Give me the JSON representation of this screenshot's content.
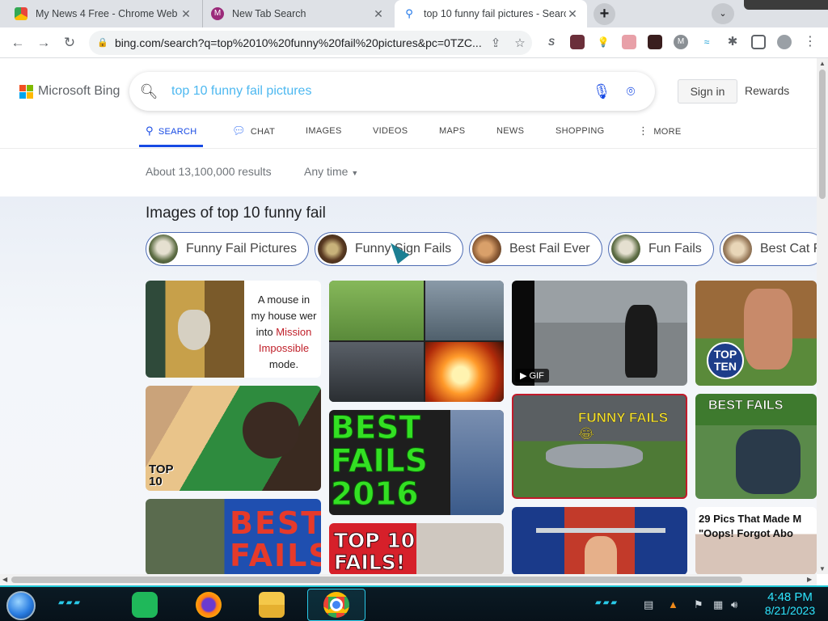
{
  "tabs": [
    {
      "title": "My News 4 Free - Chrome Web S",
      "close": "✕",
      "favicon_color": "#e8453c"
    },
    {
      "title": "New Tab Search",
      "close": "✕",
      "favicon_color": "#9b2a7a"
    },
    {
      "title": "top 10 funny fail pictures - Search",
      "close": "✕",
      "favicon_color": "#1a73e8"
    }
  ],
  "browser": {
    "new_tab": "+",
    "url": "bing.com/search?q=top%2010%20funny%20fail%20pictures&pc=0TZC...",
    "back": "←",
    "forward": "→",
    "reload": "↻"
  },
  "bing": {
    "brand": "Microsoft Bing",
    "query": "top 10 funny fail pictures",
    "sign_in": "Sign in",
    "rewards": "Rewards",
    "scopes": [
      {
        "label": "SEARCH",
        "active": true
      },
      {
        "label": "CHAT",
        "active": false
      },
      {
        "label": "IMAGES",
        "active": false
      },
      {
        "label": "VIDEOS",
        "active": false
      },
      {
        "label": "MAPS",
        "active": false
      },
      {
        "label": "NEWS",
        "active": false
      },
      {
        "label": "SHOPPING",
        "active": false
      },
      {
        "label": "MORE",
        "active": false
      }
    ],
    "result_count": "About 13,100,000 results",
    "time_filter": "Any time",
    "images_title": "Images of top 10 funny fail",
    "chips": [
      "Funny Fail Pictures",
      "Funny Sign Fails",
      "Best Fail Ever",
      "Fun Fails",
      "Best Cat F"
    ],
    "tiles": {
      "mouse_caption_1": "A mouse in",
      "mouse_caption_2": "my house wer",
      "mouse_caption_3": "into",
      "mouse_caption_4": "Mission",
      "mouse_caption_5": "Impossible",
      "mouse_caption_6": "mode.",
      "top_ten_1": "TOP",
      "top_ten_2": "TEN",
      "gif_badge": "▶ GIF",
      "funny_fails": "FUNNY FAILS 😂",
      "best_fails": "BEST FAILS",
      "top10_chimp_1": "TOP",
      "top10_chimp_2": "10",
      "best_fails_2016_1": "BEST",
      "best_fails_2016_2": "FAILS",
      "best_fails_2016_3": "2016",
      "best_red_1": "BEST",
      "best_red_2": "FAILS",
      "top10_fails_1": "TOP 10",
      "top10_fails_2": "FAILS!",
      "pics_1": "29 Pics That Made M",
      "pics_2": "\"Oops! Forgot Abo"
    }
  },
  "taskbar": {
    "time": "4:48 PM",
    "date": "8/21/2023"
  },
  "colors": {
    "bing_blue": "#174ae4",
    "query_color": "#4db8f0",
    "taskbar_accent": "#29c9e8"
  }
}
